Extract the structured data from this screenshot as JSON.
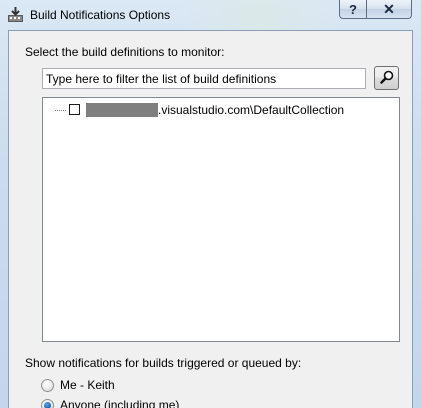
{
  "window": {
    "title": "Build Notifications Options",
    "icon": "build-notifications-icon",
    "help_label": "?",
    "close_label": "✕"
  },
  "monitor": {
    "heading": "Select the build definitions to monitor:",
    "filter_placeholder": "Type here to filter the list of build definitions",
    "search_icon": "magnifier-icon",
    "tree_items": [
      {
        "label": ".visualstudio.com\\DefaultCollection",
        "checked": false,
        "prefix_redacted": true
      }
    ]
  },
  "triggered_by": {
    "heading": "Show notifications for builds triggered or queued by:",
    "options": [
      {
        "label": "Me - Keith",
        "selected": false
      },
      {
        "label": "Anyone (including me)",
        "selected": true
      }
    ]
  },
  "colors": {
    "frame": "#c4d6ea",
    "client": "#f0f0f0",
    "redaction": "#7f7f7f"
  }
}
